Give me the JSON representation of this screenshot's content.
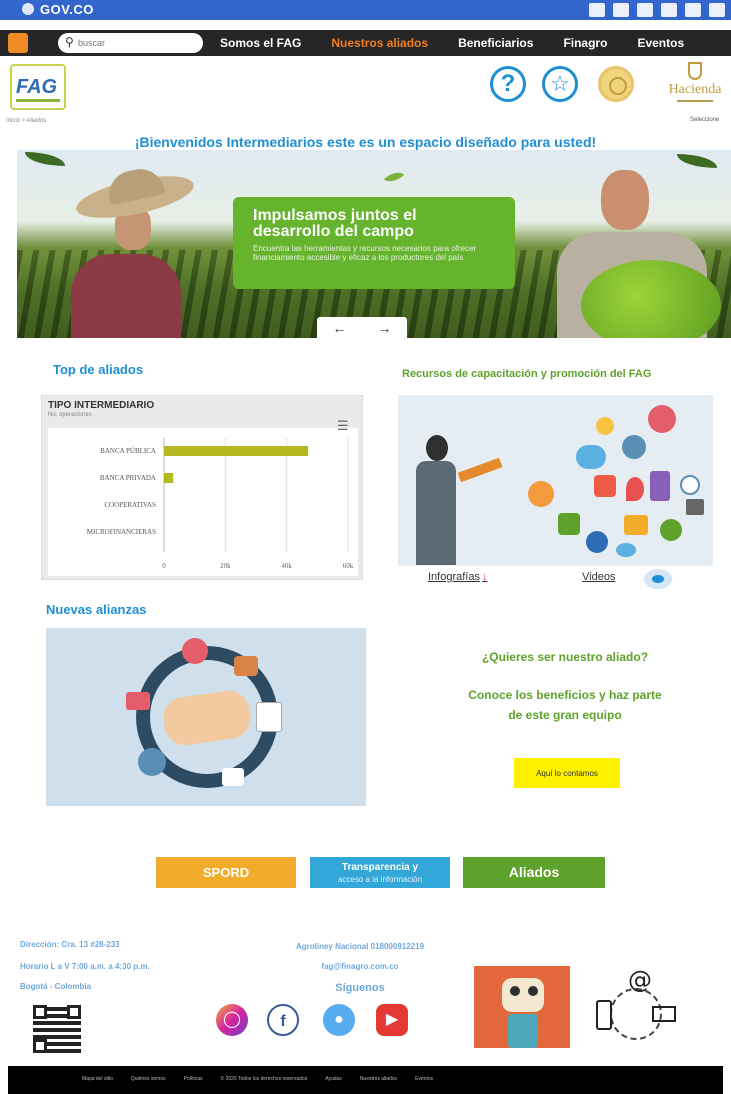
{
  "gov": {
    "logo": "GOV.CO"
  },
  "nav": {
    "search_placeholder": "buscar",
    "items": [
      "Somos el FAG",
      "Nuestros aliados",
      "Beneficiarios",
      "Finagro",
      "Eventos"
    ],
    "active_index": 1
  },
  "header": {
    "logo": "FAG",
    "logo_sub": "Inicio > Aliados",
    "help_glyph": "?",
    "hacienda": "Hacienda",
    "language": "Seleccione"
  },
  "welcome": "¡Bienvenidos Intermediarios este es un espacio diseñado para usted!",
  "hero": {
    "title_line1": "Impulsamos juntos el",
    "title_line2": "desarrollo del campo",
    "text": "Encuentra las herramientas y recursos necesarios para ofrecer financiamiento accesible y eficaz a los productores del país",
    "prev": "←",
    "next": "→"
  },
  "top_aliados": {
    "title": "Top de aliados"
  },
  "chart_data": {
    "type": "bar",
    "orientation": "horizontal",
    "title": "TIPO INTERMEDIARIO",
    "subtitle": "No. operaciones",
    "categories": [
      "BANCA PÚBLICA",
      "BANCA PRIVADA",
      "COOPERATIVAS",
      "MICROFINANCIERAS"
    ],
    "values": [
      47,
      3,
      0,
      0
    ],
    "xlim": [
      0,
      60
    ],
    "xticks": [
      "0",
      "20k",
      "40k",
      "60k"
    ],
    "color": "#b5b820"
  },
  "recursos": {
    "title": "Recursos de capacitación y promoción del FAG",
    "infografias": "Infografías",
    "videos": "Videos"
  },
  "alianzas": {
    "title": "Nuevas alianzas"
  },
  "cta": {
    "question": "¿Quieres ser nuestro aliado?",
    "text_line1": "Conoce los beneficios y haz parte",
    "text_line2": "de este gran equipo",
    "button": "Aquí lo contamos"
  },
  "bottom_buttons": {
    "sporo": "SPORD",
    "transparencia_line1": "Transparencia y",
    "transparencia_line2": "acceso a la información",
    "aliados": "Aliados"
  },
  "footer": {
    "address": "Dirección: Cra. 13 #28-233",
    "hours": "Horario L a V 7:00 a.m. a 4:30 p.m.",
    "city": "Bogotá - Colombia",
    "phone": "Agroliney Nacional 018000912219",
    "email": "fag@finagro.com.co",
    "follow": "Síguenos",
    "links": [
      "Mapa del sitio",
      "Quiénes somos",
      "Políticas",
      "© 2020 Todos los derechos reservados",
      "Ayudas",
      "Nuestros aliados",
      "Eventos"
    ]
  },
  "colors": {
    "gov_blue": "#3366cc",
    "nav_dark": "#262626",
    "accent_orange": "#f07d1e",
    "title_blue": "#1e8fd6",
    "green": "#5ea22c",
    "yellow": "#fff200"
  }
}
